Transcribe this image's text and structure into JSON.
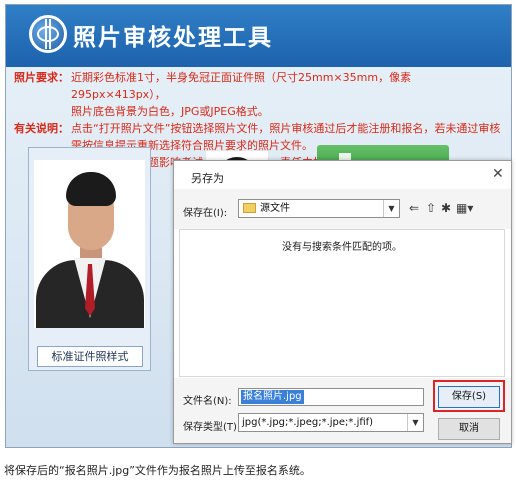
{
  "app": {
    "title": "照片审核处理工具"
  },
  "notes": {
    "requirement_label": "照片要求：",
    "requirement_lines": [
      "近期彩色标准1寸，半身免冠正面证件照（尺寸25mm×35mm，像素295px×413px），",
      "照片底色背景为白色，JPG或JPEG格式。"
    ],
    "explanation_label": "有关说明：",
    "explanation_lines": [
      "点击“打开照片文件”按钮选择照片文件，照片审核通过后才能注册和报名，若未通过审核",
      "需按信息提示重新选择符合照片要求的照片文件。",
      "如因照片质量问题影响考试、成绩和证书，责任由报考人员自负。"
    ]
  },
  "sample": {
    "label": "标准证件照样式"
  },
  "dialog": {
    "title": "另存为",
    "close_symbol": "✕",
    "save_in_label": "保存在(I):",
    "save_in_value": "源文件",
    "empty_message": "没有与搜索条件匹配的项。",
    "filename_label": "文件名(N):",
    "filename_value": "报名照片.jpg",
    "filetype_label": "保存类型(T):",
    "filetype_value": "jpg(*.jpg;*.jpeg;*.jpe;*.jfif)",
    "save_button": "保存(S)",
    "cancel_button": "取消"
  },
  "caption": "将保存后的“报名照片.jpg”文件作为报名照片上传至报名系统。",
  "colors": {
    "header_blue": "#1d62ac",
    "note_red": "#d62a1a",
    "highlight_red": "#d9262a",
    "selection_blue": "#3a80d8"
  },
  "icons": [
    "folder-icon",
    "back-arrow-icon",
    "up-folder-icon",
    "new-folder-icon",
    "view-menu-icon",
    "close-icon"
  ]
}
